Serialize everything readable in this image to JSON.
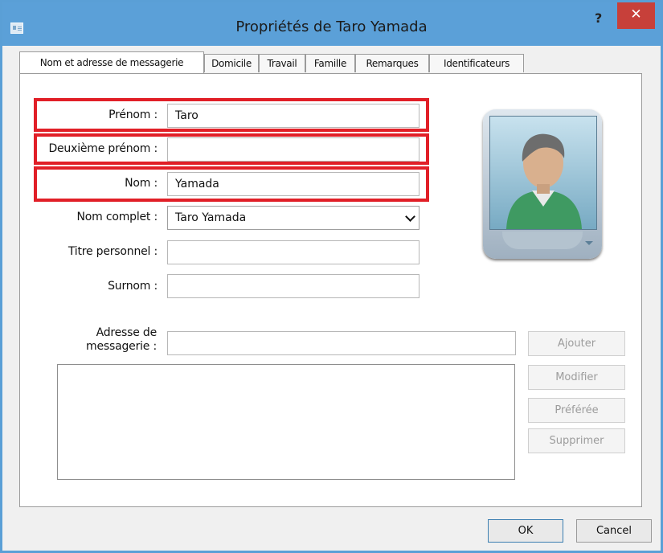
{
  "window": {
    "title": "Propriétés de Taro Yamada",
    "help_glyph": "?",
    "close_glyph": "✕"
  },
  "tabs": [
    {
      "label": "Nom et adresse de messagerie",
      "active": true
    },
    {
      "label": "Domicile",
      "active": false
    },
    {
      "label": "Travail",
      "active": false
    },
    {
      "label": "Famille",
      "active": false
    },
    {
      "label": "Remarques",
      "active": false
    },
    {
      "label": "Identificateurs",
      "active": false
    }
  ],
  "form": {
    "prenom": {
      "label": "Prénom :",
      "value": "Taro"
    },
    "deuxieme_prenom": {
      "label": "Deuxième prénom :",
      "value": ""
    },
    "nom": {
      "label": "Nom :",
      "value": "Yamada"
    },
    "nom_complet": {
      "label": "Nom complet :",
      "value": "Taro Yamada"
    },
    "titre_personnel": {
      "label": "Titre personnel :",
      "value": ""
    },
    "surnom": {
      "label": "Surnom :",
      "value": ""
    }
  },
  "email": {
    "label_line1": "Adresse de",
    "label_line2": "messagerie :",
    "value": ""
  },
  "side_buttons": {
    "ajouter": "Ajouter",
    "modifier": "Modifier",
    "preferee": "Préférée",
    "supprimer": "Supprimer"
  },
  "footer": {
    "ok": "OK",
    "cancel": "Cancel"
  },
  "colors": {
    "highlight": "#e11f27",
    "titlebar": "#5ba0d8",
    "close": "#c7403a"
  },
  "icons": [
    "contact-card-icon",
    "help-icon",
    "close-icon",
    "chevron-down-icon",
    "contact-photo",
    "photo-menu-icon"
  ]
}
